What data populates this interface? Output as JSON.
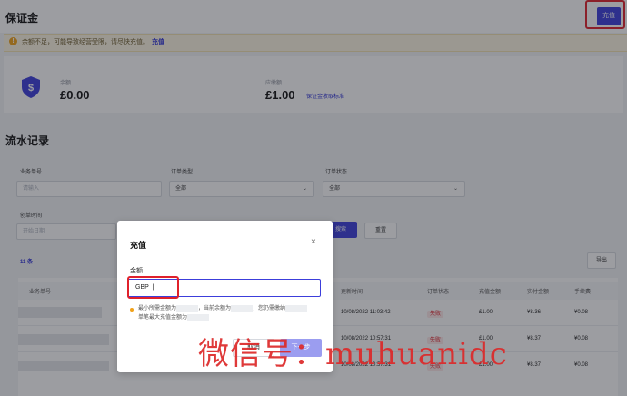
{
  "header": {
    "title": "保证金",
    "recharge_label": "充值"
  },
  "warning": {
    "text": "余额不足，可能导致经营受限，请尽快充值。",
    "link": "充值"
  },
  "balance": {
    "label": "余额",
    "value": "£0.00"
  },
  "due": {
    "label": "应缴额",
    "value": "£1.00",
    "link": "保证金收取标准"
  },
  "records": {
    "title": "流水记录"
  },
  "filters": {
    "order_no_label": "业务单号",
    "order_no_placeholder": "请输入",
    "order_type_label": "订单类型",
    "order_type_value": "全部",
    "order_status_label": "订单状态",
    "order_status_value": "全部",
    "created_label": "创单时间",
    "start_placeholder": "开始日期",
    "search_label": "搜索",
    "reset_label": "重置"
  },
  "count_text": "11 条",
  "export_label": "导出",
  "table": {
    "columns": [
      "业务单号",
      "更新时间",
      "订单状态",
      "充值金额",
      "实付金额",
      "手续费"
    ],
    "rows": [
      {
        "time": "10/08/2022 11:03:42",
        "status": "失败",
        "amount": "£1.00",
        "paid": "¥8.36",
        "fee": "¥0.08"
      },
      {
        "time": "10/08/2022 10:57:31",
        "status": "失败",
        "amount": "£1.00",
        "paid": "¥8.37",
        "fee": "¥0.08"
      },
      {
        "time": "10/08/2022 10:57:31",
        "status": "失败",
        "amount": "£1.00",
        "paid": "¥8.37",
        "fee": "¥0.08"
      }
    ]
  },
  "modal": {
    "title": "充值",
    "close": "×",
    "amount_label": "金额",
    "currency": "GBP",
    "hint_line1_a": "最小所需金额为",
    "hint_line1_b": "，当前余额为",
    "hint_line1_c": "，您仍需缴纳",
    "hint_line2": "单笔最大充值金额为",
    "cancel_label": "取消",
    "next_label": "下一步"
  },
  "watermark": "微信号：muhuanidc",
  "colors": {
    "accent": "#3c3edb",
    "warning": "#f1a21a",
    "error": "#e0212b",
    "highlight_box": "#e0212b"
  }
}
